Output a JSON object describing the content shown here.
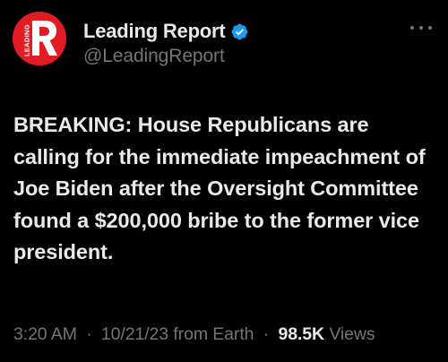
{
  "author": {
    "display_name": "Leading Report",
    "handle": "@LeadingReport",
    "verified": true,
    "avatar_logo_text": "LEADING",
    "avatar_logo_letter": "R",
    "brand_color": "#e31b23",
    "verified_color": "#1d9bf0"
  },
  "tweet": {
    "text": "BREAKING: House Republicans are calling for the immediate impeachment of Joe Biden after the Oversight Committee found a $200,000 bribe to the former vice president."
  },
  "meta": {
    "time": "3:20 AM",
    "date": "10/21/23",
    "source": "from Earth",
    "views_count": "98.5K",
    "views_label": "Views",
    "separator": "·"
  },
  "icons": {
    "more": "more-options-icon",
    "verified": "verified-badge-icon"
  },
  "theme": {
    "background": "#000000",
    "primary_text": "#e7e9ea",
    "secondary_text": "#71767b"
  }
}
